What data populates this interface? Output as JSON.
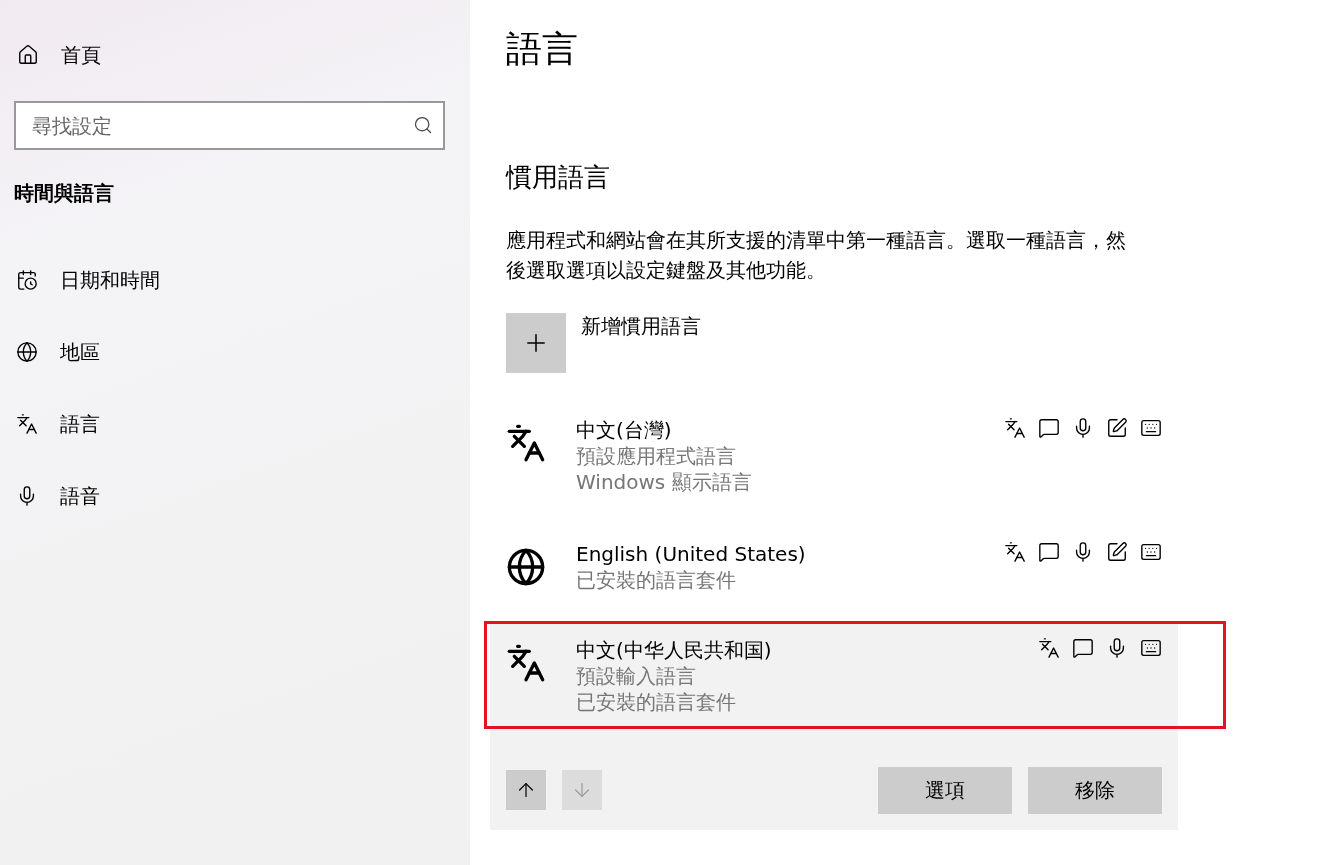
{
  "sidebar": {
    "home": "首頁",
    "search": {
      "placeholder": "尋找設定"
    },
    "section_title": "時間與語言",
    "items": [
      {
        "label": "日期和時間",
        "selected": false
      },
      {
        "label": "地區",
        "selected": false
      },
      {
        "label": "語言",
        "selected": false
      },
      {
        "label": "語音",
        "selected": false
      }
    ]
  },
  "page": {
    "title": "語言",
    "section_title": "慣用語言",
    "description": "應用程式和網站會在其所支援的清單中第一種語言。選取一種語言，然後選取選項以設定鍵盤及其他功能。",
    "add_label": "新增慣用語言",
    "languages": [
      {
        "name": "中文(台灣)",
        "details": [
          "預設應用程式語言",
          "Windows 顯示語言"
        ],
        "kind": "installed",
        "handwriting": true,
        "selected": false
      },
      {
        "name": "English (United States)",
        "details": [
          "已安裝的語言套件"
        ],
        "kind": "pack",
        "handwriting": true,
        "selected": false
      },
      {
        "name": "中文(中华人民共和国)",
        "details": [
          "預設輸入語言",
          "已安裝的語言套件"
        ],
        "kind": "installed",
        "handwriting": false,
        "selected": true
      }
    ],
    "move_up": {
      "disabled": false
    },
    "move_down": {
      "disabled": true
    },
    "buttons": [
      "選項",
      "移除"
    ]
  }
}
